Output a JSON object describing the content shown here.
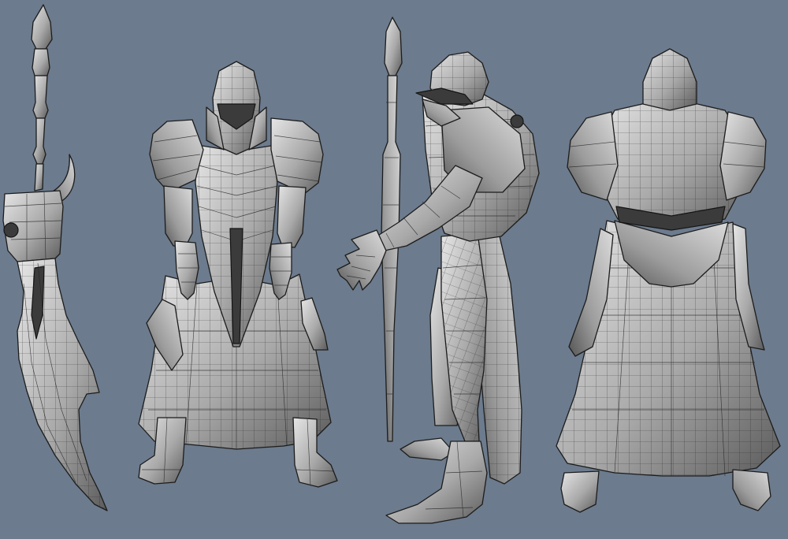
{
  "viewport": {
    "background": "#6c7b8d",
    "shading": {
      "light": "#e6e6e6",
      "mid": "#a9a9a9",
      "dark": "#4a4a4a",
      "edge": "#1c1c1c"
    }
  },
  "models": [
    {
      "id": "scimitar",
      "view": "sword"
    },
    {
      "id": "knight-front",
      "view": "front"
    },
    {
      "id": "knight-side",
      "view": "side"
    },
    {
      "id": "knight-back",
      "view": "back"
    }
  ]
}
